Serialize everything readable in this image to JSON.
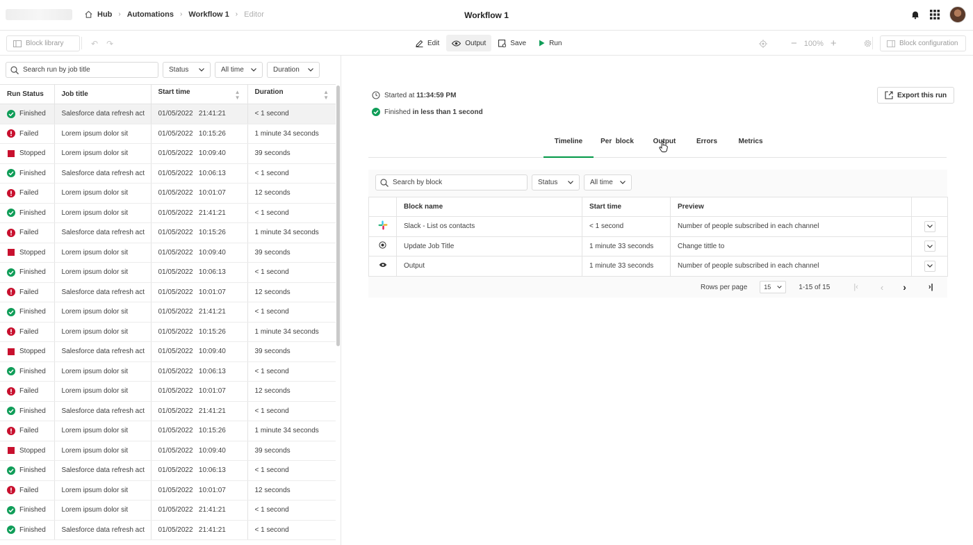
{
  "header": {
    "breadcrumb": [
      "Hub",
      "Automations",
      "Workflow 1",
      "Editor"
    ],
    "title": "Workflow 1"
  },
  "toolbar": {
    "block_library": "Block library",
    "edit": "Edit",
    "output": "Output",
    "save": "Save",
    "run": "Run",
    "zoom": "100%",
    "block_configuration": "Block configuration"
  },
  "left": {
    "search_placeholder": "Search run by job title",
    "filters": [
      "Status",
      "All time",
      "Duration"
    ],
    "columns": [
      "Run Status",
      "Job title",
      "Start time",
      "Duration"
    ],
    "rows": [
      {
        "status": "Finished",
        "title": "Salesforce data refresh act",
        "date": "01/05/2022",
        "time": "21:41:21",
        "duration": "< 1 second"
      },
      {
        "status": "Failed",
        "title": "Lorem ipsum dolor sit",
        "date": "01/05/2022",
        "time": "10:15:26",
        "duration": "1 minute 34 seconds"
      },
      {
        "status": "Stopped",
        "title": "Lorem ipsum dolor sit",
        "date": "01/05/2022",
        "time": "10:09:40",
        "duration": "39 seconds"
      },
      {
        "status": "Finished",
        "title": "Salesforce data refresh act",
        "date": "01/05/2022",
        "time": "10:06:13",
        "duration": "< 1 second"
      },
      {
        "status": "Failed",
        "title": "Lorem ipsum dolor sit",
        "date": "01/05/2022",
        "time": "10:01:07",
        "duration": "12 seconds"
      },
      {
        "status": "Finished",
        "title": "Lorem ipsum dolor sit",
        "date": "01/05/2022",
        "time": "21:41:21",
        "duration": "< 1 second"
      },
      {
        "status": "Failed",
        "title": "Salesforce data refresh act",
        "date": "01/05/2022",
        "time": "10:15:26",
        "duration": "1 minute 34 seconds"
      },
      {
        "status": "Stopped",
        "title": "Lorem ipsum dolor sit",
        "date": "01/05/2022",
        "time": "10:09:40",
        "duration": "39 seconds"
      },
      {
        "status": "Finished",
        "title": "Lorem ipsum dolor sit",
        "date": "01/05/2022",
        "time": "10:06:13",
        "duration": "< 1 second"
      },
      {
        "status": "Failed",
        "title": "Salesforce data refresh act",
        "date": "01/05/2022",
        "time": "10:01:07",
        "duration": "12 seconds"
      },
      {
        "status": "Finished",
        "title": "Lorem ipsum dolor sit",
        "date": "01/05/2022",
        "time": "21:41:21",
        "duration": "< 1 second"
      },
      {
        "status": "Failed",
        "title": "Lorem ipsum dolor sit",
        "date": "01/05/2022",
        "time": "10:15:26",
        "duration": "1 minute 34 seconds"
      },
      {
        "status": "Stopped",
        "title": "Salesforce data refresh act",
        "date": "01/05/2022",
        "time": "10:09:40",
        "duration": "39 seconds"
      },
      {
        "status": "Finished",
        "title": "Lorem ipsum dolor sit",
        "date": "01/05/2022",
        "time": "10:06:13",
        "duration": "< 1 second"
      },
      {
        "status": "Failed",
        "title": "Lorem ipsum dolor sit",
        "date": "01/05/2022",
        "time": "10:01:07",
        "duration": "12 seconds"
      },
      {
        "status": "Finished",
        "title": "Salesforce data refresh act",
        "date": "01/05/2022",
        "time": "21:41:21",
        "duration": "< 1 second"
      },
      {
        "status": "Failed",
        "title": "Lorem ipsum dolor sit",
        "date": "01/05/2022",
        "time": "10:15:26",
        "duration": "1 minute 34 seconds"
      },
      {
        "status": "Stopped",
        "title": "Lorem ipsum dolor sit",
        "date": "01/05/2022",
        "time": "10:09:40",
        "duration": "39 seconds"
      },
      {
        "status": "Finished",
        "title": "Salesforce data refresh act",
        "date": "01/05/2022",
        "time": "10:06:13",
        "duration": "< 1 second"
      },
      {
        "status": "Failed",
        "title": "Lorem ipsum dolor sit",
        "date": "01/05/2022",
        "time": "10:01:07",
        "duration": "12 seconds"
      },
      {
        "status": "Finished",
        "title": "Lorem ipsum dolor sit",
        "date": "01/05/2022",
        "time": "21:41:21",
        "duration": "< 1 second"
      },
      {
        "status": "Finished",
        "title": "Salesforce data refresh act",
        "date": "01/05/2022",
        "time": "21:41:21",
        "duration": "< 1 second"
      }
    ]
  },
  "detail": {
    "started_label": "Started at ",
    "started_time": "11:34:59 PM",
    "finished_label": "Finished ",
    "finished_value": "in less than 1 second",
    "export": "Export this run",
    "tabs": [
      "Timeline",
      "Per  block",
      "Output",
      "Errors",
      "Metrics"
    ],
    "search_placeholder": "Search by block",
    "filters": [
      "Status",
      "All time"
    ],
    "columns": [
      "Block name",
      "Start time",
      "Preview"
    ],
    "rows": [
      {
        "icon": "slack-icon",
        "name": "Slack - List os contacts",
        "start": "< 1 second",
        "preview": "Number of people subscribed in each channel"
      },
      {
        "icon": "target-icon",
        "name": "Update Job Title",
        "start": "1 minute 33 seconds",
        "preview": "Change tittle to"
      },
      {
        "icon": "eye-icon",
        "name": "Output",
        "start": "1 minute 33 seconds",
        "preview": "Number of people subscribed in each channel"
      }
    ],
    "pager": {
      "rows_per_page_label": "Rows per page",
      "rows_per_page": "15",
      "range": "1-15 of 15"
    }
  },
  "colors": {
    "success": "#0f9d58",
    "error": "#c8102e",
    "stopped": "#c8102e",
    "tab_accent": "#009845"
  }
}
